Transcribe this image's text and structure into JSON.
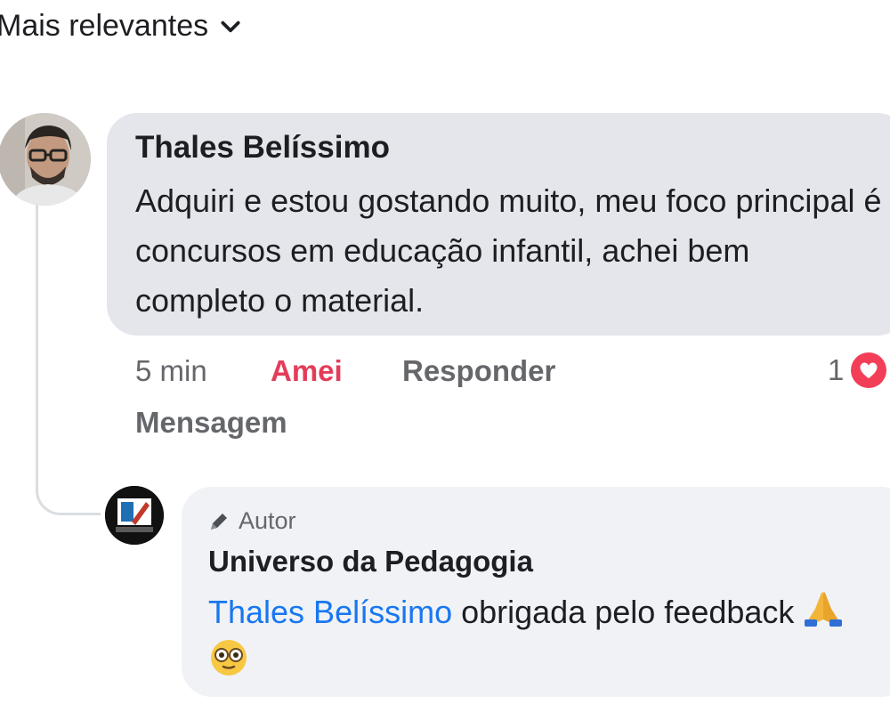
{
  "sort": {
    "label": "Mais relevantes",
    "icon": "chevron-down-icon"
  },
  "comment": {
    "author": "Thales Belíssimo",
    "text": "Adquiri e estou gostando muito, meu foco principal é concursos em educação infantil, achei bem completo o material.",
    "time": "5 min",
    "love_label": "Amei",
    "reply_label": "Responder",
    "message_label": "Mensagem",
    "reaction_count": "1",
    "reaction_icon": "heart-icon"
  },
  "reply": {
    "badge": "Autor",
    "badge_icon": "pencil-icon",
    "author": "Universo da Pedagogia",
    "mention": "Thales Belíssimo",
    "text": " obrigada pelo feedback ",
    "emoji": [
      "praying-hands-icon",
      "flushed-face-icon"
    ]
  },
  "colors": {
    "accent": "#1877f2",
    "love": "#e33d5a",
    "bubble": "#e4e6eb",
    "reply_bubble": "#f0f2f5",
    "muted": "#65676b"
  }
}
